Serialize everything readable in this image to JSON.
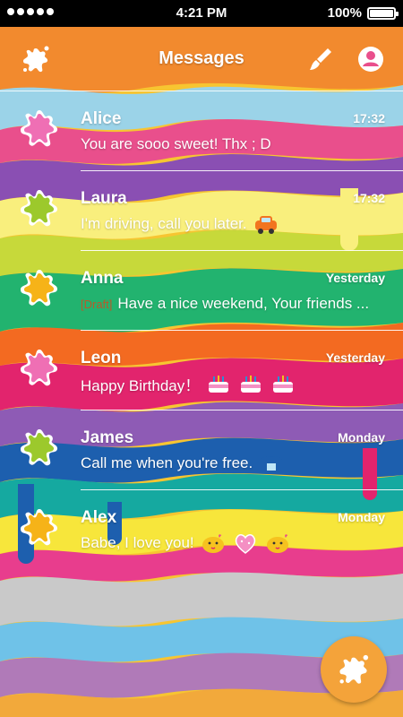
{
  "status_bar": {
    "time": "4:21 PM",
    "battery": "100%"
  },
  "header": {
    "title": "Messages"
  },
  "colors": {
    "fab": "#f4a33a",
    "draft_label": "#b85a2a",
    "text": "#ffffff"
  },
  "conversations": [
    {
      "name": "Alice",
      "time": "17:32",
      "preview": "You are sooo sweet! Thx ; D",
      "avatar": "pink-splat-icon"
    },
    {
      "name": "Laura",
      "time": "17:32",
      "preview": "I'm driving, call you later.",
      "avatar": "green-splat-icon",
      "emoji": "car-icon"
    },
    {
      "name": "Anna",
      "time": "Yesterday",
      "draft_label": "[Draft]",
      "preview": "Have a nice weekend, Your friends ...",
      "avatar": "yellow-splat-icon"
    },
    {
      "name": "Leon",
      "time": "Yesterday",
      "preview": "Happy Birthday！",
      "avatar": "pink-splat-icon",
      "emoji": "cake-icon"
    },
    {
      "name": "James",
      "time": "Monday",
      "preview": "Call me when you're free.",
      "avatar": "green-splat-icon",
      "emoji": "telephone-icon"
    },
    {
      "name": "Alex",
      "time": "Monday",
      "preview": "Babe, I love you!",
      "avatar": "yellow-splat-icon",
      "emoji": "kiss-heart-icon"
    }
  ]
}
